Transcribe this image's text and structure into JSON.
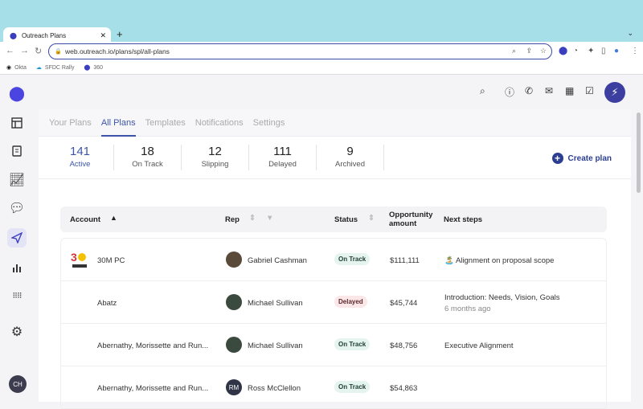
{
  "browser": {
    "tab_title": "Outreach Plans",
    "url": "web.outreach.io/plans/spl/all-plans",
    "bookmarks": [
      "Okta",
      "SFDC Rally",
      "360"
    ]
  },
  "colors": {
    "accent": "#3d55a8",
    "brand": "#3c3f9f"
  },
  "user": {
    "initials": "CH"
  },
  "tabs": [
    {
      "label": "Your Plans"
    },
    {
      "label": "All Plans",
      "selected": true
    },
    {
      "label": "Templates"
    },
    {
      "label": "Notifications"
    },
    {
      "label": "Settings"
    }
  ],
  "stats": [
    {
      "value": "141",
      "label": "Active"
    },
    {
      "value": "18",
      "label": "On Track"
    },
    {
      "value": "12",
      "label": "Slipping"
    },
    {
      "value": "111",
      "label": "Delayed"
    },
    {
      "value": "9",
      "label": "Archived"
    }
  ],
  "create_label": "Create plan",
  "table": {
    "headers": {
      "account": "Account",
      "rep": "Rep",
      "status": "Status",
      "amount": "Opportunity amount",
      "next": "Next steps"
    },
    "rows": [
      {
        "account": "30M PC",
        "rep": "Gabriel Cashman",
        "status": "On Track",
        "amount": "$111,111",
        "next": "🏝️ Alignment on proposal scope",
        "sub": ""
      },
      {
        "account": "Abatz",
        "rep": "Michael Sullivan",
        "status": "Delayed",
        "amount": "$45,744",
        "next": "Introduction: Needs, Vision, Goals",
        "sub": "6 months ago"
      },
      {
        "account": "Abernathy, Morissette and Run...",
        "rep": "Michael Sullivan",
        "status": "On Track",
        "amount": "$48,756",
        "next": "Executive Alignment",
        "sub": ""
      },
      {
        "account": "Abernathy, Morissette and Run...",
        "rep": "Ross McClellon",
        "rep_initials": "RM",
        "status": "On Track",
        "amount": "$54,863",
        "next": "",
        "sub": ""
      }
    ]
  }
}
